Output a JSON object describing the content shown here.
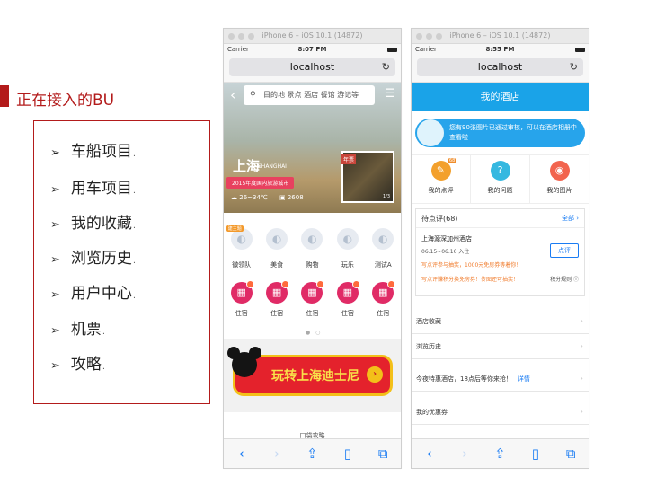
{
  "slide": {
    "heading": "正在接入的BU",
    "items": [
      {
        "label": "车船项目",
        "suffix": "."
      },
      {
        "label": "用车项目",
        "suffix": "."
      },
      {
        "label": "我的收藏",
        "suffix": "."
      },
      {
        "label": "浏览历史",
        "suffix": "."
      },
      {
        "label": "用户中心",
        "suffix": "."
      },
      {
        "label": "机票",
        "suffix": "."
      },
      {
        "label": "攻略",
        "suffix": "."
      }
    ]
  },
  "phone1": {
    "sim_title": "iPhone 6 – iOS 10.1 (14872)",
    "carrier": "Carrier",
    "time": "8:07 PM",
    "url": "localhost",
    "search_placeholder": "目的地 景点 酒店 餐馆 游记等",
    "city": "上海",
    "city_en": "SHANGHAI",
    "tag": "2015年度国内旅游城市",
    "weather": "26~34℃",
    "photo_count": "2608",
    "thumb_ribbon": "年票",
    "thumb_pager": "1/3",
    "categories": [
      {
        "label": "微领队",
        "badge": "建主题"
      },
      {
        "label": "美食",
        "badge": ""
      },
      {
        "label": "购物",
        "badge": ""
      },
      {
        "label": "玩乐",
        "badge": ""
      },
      {
        "label": "测试A",
        "badge": ""
      }
    ],
    "hotels": [
      "住宿",
      "住宿",
      "住宿",
      "住宿",
      "住宿"
    ],
    "banner_text": "玩转上海迪士尼",
    "section_title": "口袋攻略"
  },
  "phone2": {
    "sim_title": "iPhone 6 – iOS 10.1 (14872)",
    "carrier": "Carrier",
    "time": "8:55 PM",
    "url": "localhost",
    "header_title": "我的酒店",
    "notice": "您有90张图片已通过审核，可以在酒店相册中查看啦",
    "quick": [
      {
        "label": "我的点评",
        "count": "68",
        "color": "#f3a02c"
      },
      {
        "label": "我的问题",
        "count": "",
        "color": "#35b8e0"
      },
      {
        "label": "我的图片",
        "count": "",
        "color": "#f2644e"
      }
    ],
    "pending_title": "待点评(68)",
    "pending_all": "全部",
    "hotel_name": "上海源深加州酒店",
    "stay_dates": "06.15~06.16 入住",
    "promo1": "写点评参与抽奖，1000元免房券等着你！",
    "promo2": "写点评赚积分换免房券！传图还可抽奖！",
    "rules": "积分规则",
    "review_button": "点评",
    "menu": [
      {
        "label": "酒店收藏",
        "link": ""
      },
      {
        "label": "浏览历史",
        "link": ""
      },
      {
        "label": "今夜特惠酒店，18点后等你来抢！",
        "link": "详情"
      },
      {
        "label": "我的优惠券",
        "link": ""
      }
    ]
  }
}
